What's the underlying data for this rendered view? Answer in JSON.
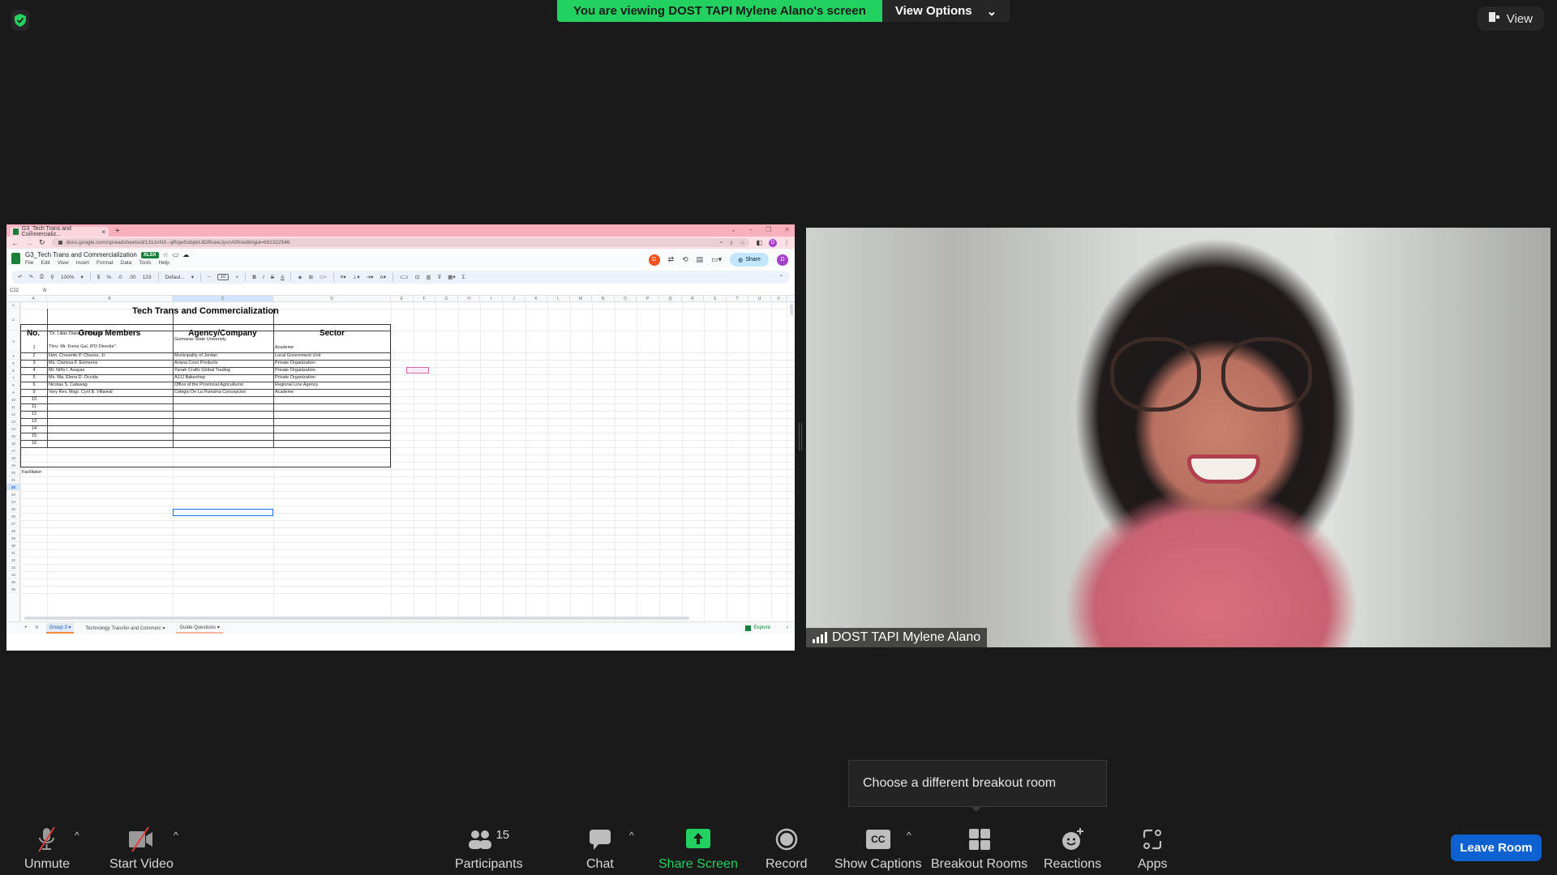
{
  "top": {
    "banner_text": "You are viewing DOST TAPI Mylene Alano's screen",
    "view_options_label": "View Options",
    "view_label": "View",
    "banner_color": "#23d160"
  },
  "browser": {
    "tab_title": "G3_Tech Trans and Commercializ...",
    "url": "docs.google.com/spreadsheets/d/131znNX--qRqwSsbpkL6DRceeJyvzA0fr/edit#gid=691322546",
    "profile_initial": "D"
  },
  "sheets": {
    "doc_title": "G3_Tech Trans and Commercialization",
    "format_badge": "XLSX",
    "menus": [
      "File",
      "Edit",
      "View",
      "Insert",
      "Format",
      "Data",
      "Tools",
      "Help"
    ],
    "share_label": "Share",
    "collaborator_initial": "D",
    "user_initial": "D",
    "toolbar": {
      "zoom": "100%",
      "currency": "$",
      "percent": "%",
      "dec_decrease": ".0",
      "dec_increase": ".00",
      "number_format": "123",
      "font": "Defaul...",
      "font_size": "10",
      "bold": "B",
      "italic": "I",
      "strike": "S",
      "text_color": "A",
      "sum": "Σ"
    },
    "name_box": "C22",
    "fx": "fx",
    "columns": [
      "A",
      "B",
      "C",
      "D",
      "E",
      "F",
      "G",
      "H",
      "I",
      "J",
      "K",
      "L",
      "M",
      "N",
      "O",
      "P",
      "Q",
      "R",
      "S",
      "T",
      "U",
      "V"
    ],
    "selected_column": "C",
    "selected_row": "22",
    "rows": [
      "1",
      "2",
      "3",
      "4",
      "5",
      "6",
      "7",
      "8",
      "9",
      "10",
      "11",
      "12",
      "13",
      "14",
      "15",
      "16",
      "17",
      "18",
      "19",
      "20",
      "21",
      "22",
      "23",
      "24",
      "25",
      "26",
      "27",
      "28",
      "29",
      "30",
      "31",
      "32",
      "33",
      "34",
      "35",
      "36"
    ],
    "table_title": "Tech Trans and Commercialization",
    "headers": {
      "no": "No.",
      "members": "Group Members",
      "agency": "Agency/Company",
      "sector": "Sector"
    },
    "entries": [
      {
        "no": "1",
        "member_line1": "\"Dr. Lilian Diana B. Parreño",
        "member_line2": "Thru: Mr. Frenz Gal, IPO Director\"",
        "agency": "Guimaras State University",
        "sector": "Academe"
      },
      {
        "no": "2",
        "member": "Hon. Cresente P. Chavez, Jr.",
        "agency": "Municipality of Jordan",
        "sector": "Local Government Unit"
      },
      {
        "no": "3",
        "member": "Ms. Clarissa F. Esmenos",
        "agency": "Ariana Coco Products",
        "sector": "Private Organization"
      },
      {
        "no": "4",
        "member": "Mr. Niño I. Asayas",
        "agency": "Yanah Crafts Global Trading",
        "sector": "Private Organization"
      },
      {
        "no": "5",
        "member": "Ms. Ma. Elena D. Occida",
        "agency": "AJJJ Bakeshop",
        "sector": "Private Organization"
      },
      {
        "no": "6",
        "member": "Nicolas S. Calawag",
        "agency": "Office of the Provincial Agriculturist",
        "sector": "Regional Line Agency"
      },
      {
        "no": "9",
        "member": "Very Rev. Msgr. Cyril B. Villareal",
        "agency": "Colegio De La Purisima Concepcion",
        "sector": "Academe"
      }
    ],
    "empty_numbers": [
      "10",
      "11",
      "12",
      "13",
      "14",
      "15",
      "16"
    ],
    "facilitator_label": "Facilitator:",
    "sheet_tabs": [
      "Group 3",
      "Technology Transfer and Commerc",
      "Guide Questions"
    ],
    "explore_label": "Explore"
  },
  "video": {
    "participant_name": "DOST TAPI Mylene Alano"
  },
  "tooltip": {
    "text": "Choose a different breakout room"
  },
  "toolbar": {
    "unmute": "Unmute",
    "start_video": "Start Video",
    "participants": "Participants",
    "participants_count": "15",
    "chat": "Chat",
    "share_screen": "Share Screen",
    "record": "Record",
    "show_captions": "Show Captions",
    "cc_glyph": "CC",
    "breakout_rooms": "Breakout Rooms",
    "reactions": "Reactions",
    "apps": "Apps",
    "leave_room": "Leave Room",
    "leave_color": "#0e61d0"
  }
}
